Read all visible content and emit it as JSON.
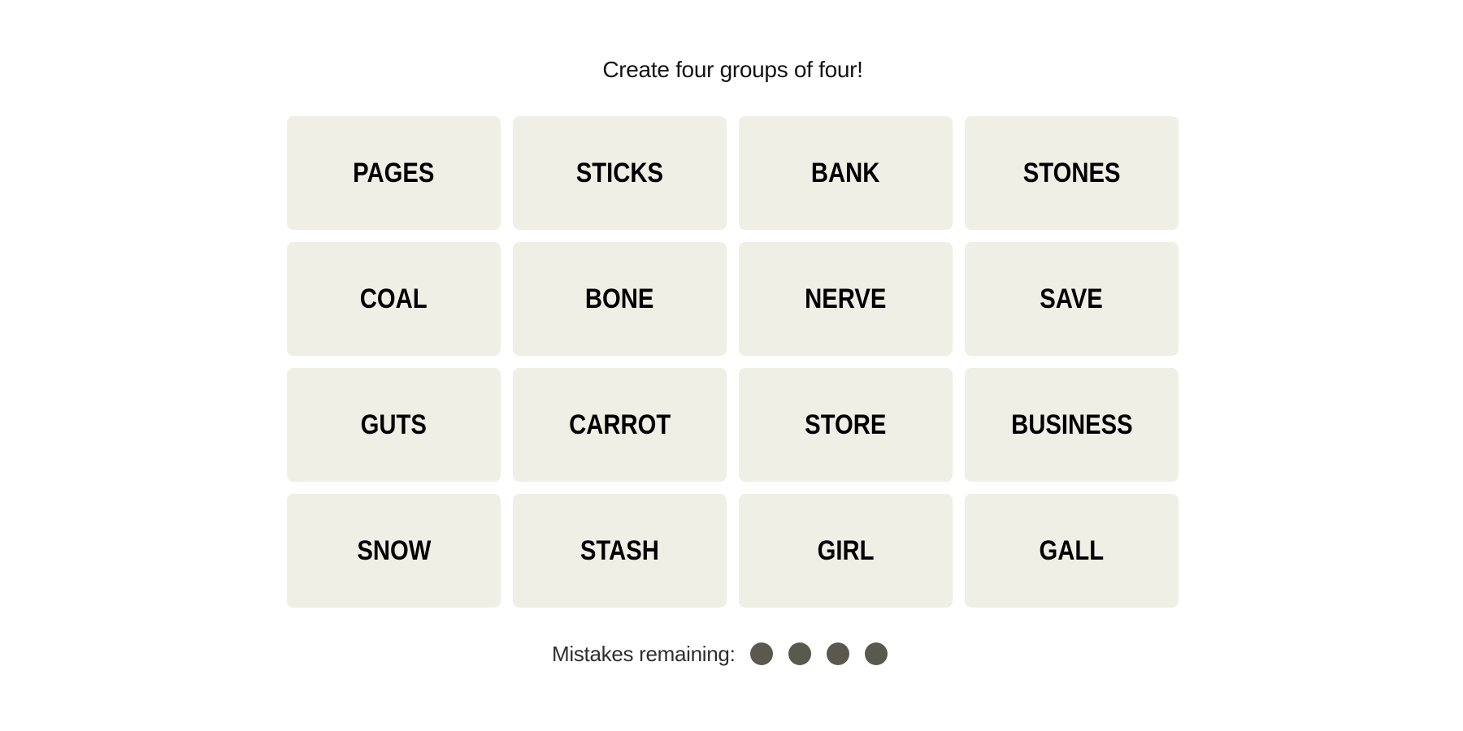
{
  "header": {
    "instruction": "Create four groups of four!"
  },
  "board": {
    "tiles": [
      {
        "word": "PAGES"
      },
      {
        "word": "STICKS"
      },
      {
        "word": "BANK"
      },
      {
        "word": "STONES"
      },
      {
        "word": "COAL"
      },
      {
        "word": "BONE"
      },
      {
        "word": "NERVE"
      },
      {
        "word": "SAVE"
      },
      {
        "word": "GUTS"
      },
      {
        "word": "CARROT"
      },
      {
        "word": "STORE"
      },
      {
        "word": "BUSINESS"
      },
      {
        "word": "SNOW"
      },
      {
        "word": "STASH"
      },
      {
        "word": "GIRL"
      },
      {
        "word": "GALL"
      }
    ]
  },
  "status": {
    "mistakes_label": "Mistakes remaining:",
    "mistakes_remaining": 4,
    "mistakes_total": 4
  },
  "colors": {
    "tile_background": "#efefe6",
    "mistake_dot": "#5a594e"
  }
}
